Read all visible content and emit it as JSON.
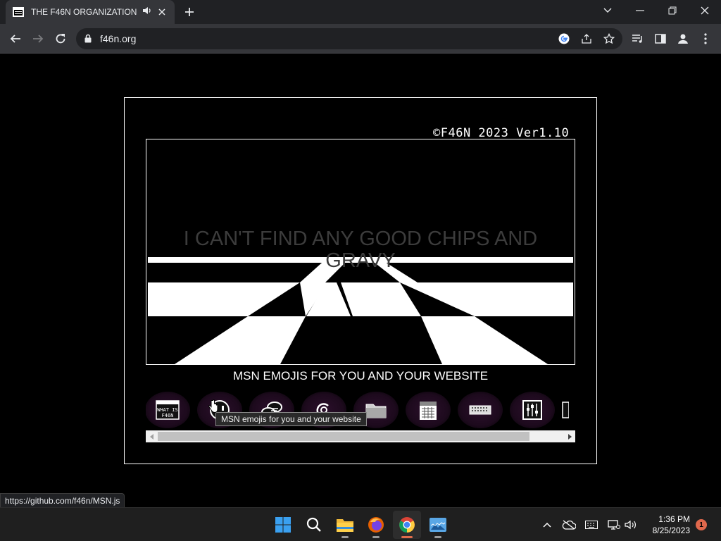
{
  "browser": {
    "tab_title": "THE F46N ORGANIZATION",
    "address": "f46n.org",
    "status_url": "https://github.com/f46n/MSN.js"
  },
  "page": {
    "version_text": "©F46N 2023 Ver1.10",
    "scene_text": "I CAN'T FIND ANY GOOD CHIPS AND GRAVY",
    "msn_title": "MSN EMOJIS FOR YOU AND YOUR WEBSITE",
    "tooltip": "MSN emojis for you and your website",
    "emoji_logo_text": "WHAT IS F46N",
    "scrollbar_position": 0.0
  },
  "taskbar": {
    "time": "1:36 PM",
    "date": "8/25/2023",
    "notifications": "1"
  },
  "colors": {
    "tab_active": "#35363a",
    "tabstrip": "#202124",
    "page_bg": "#000000",
    "taskbar": "#1f1f1f",
    "accent": "#e06c4c"
  }
}
